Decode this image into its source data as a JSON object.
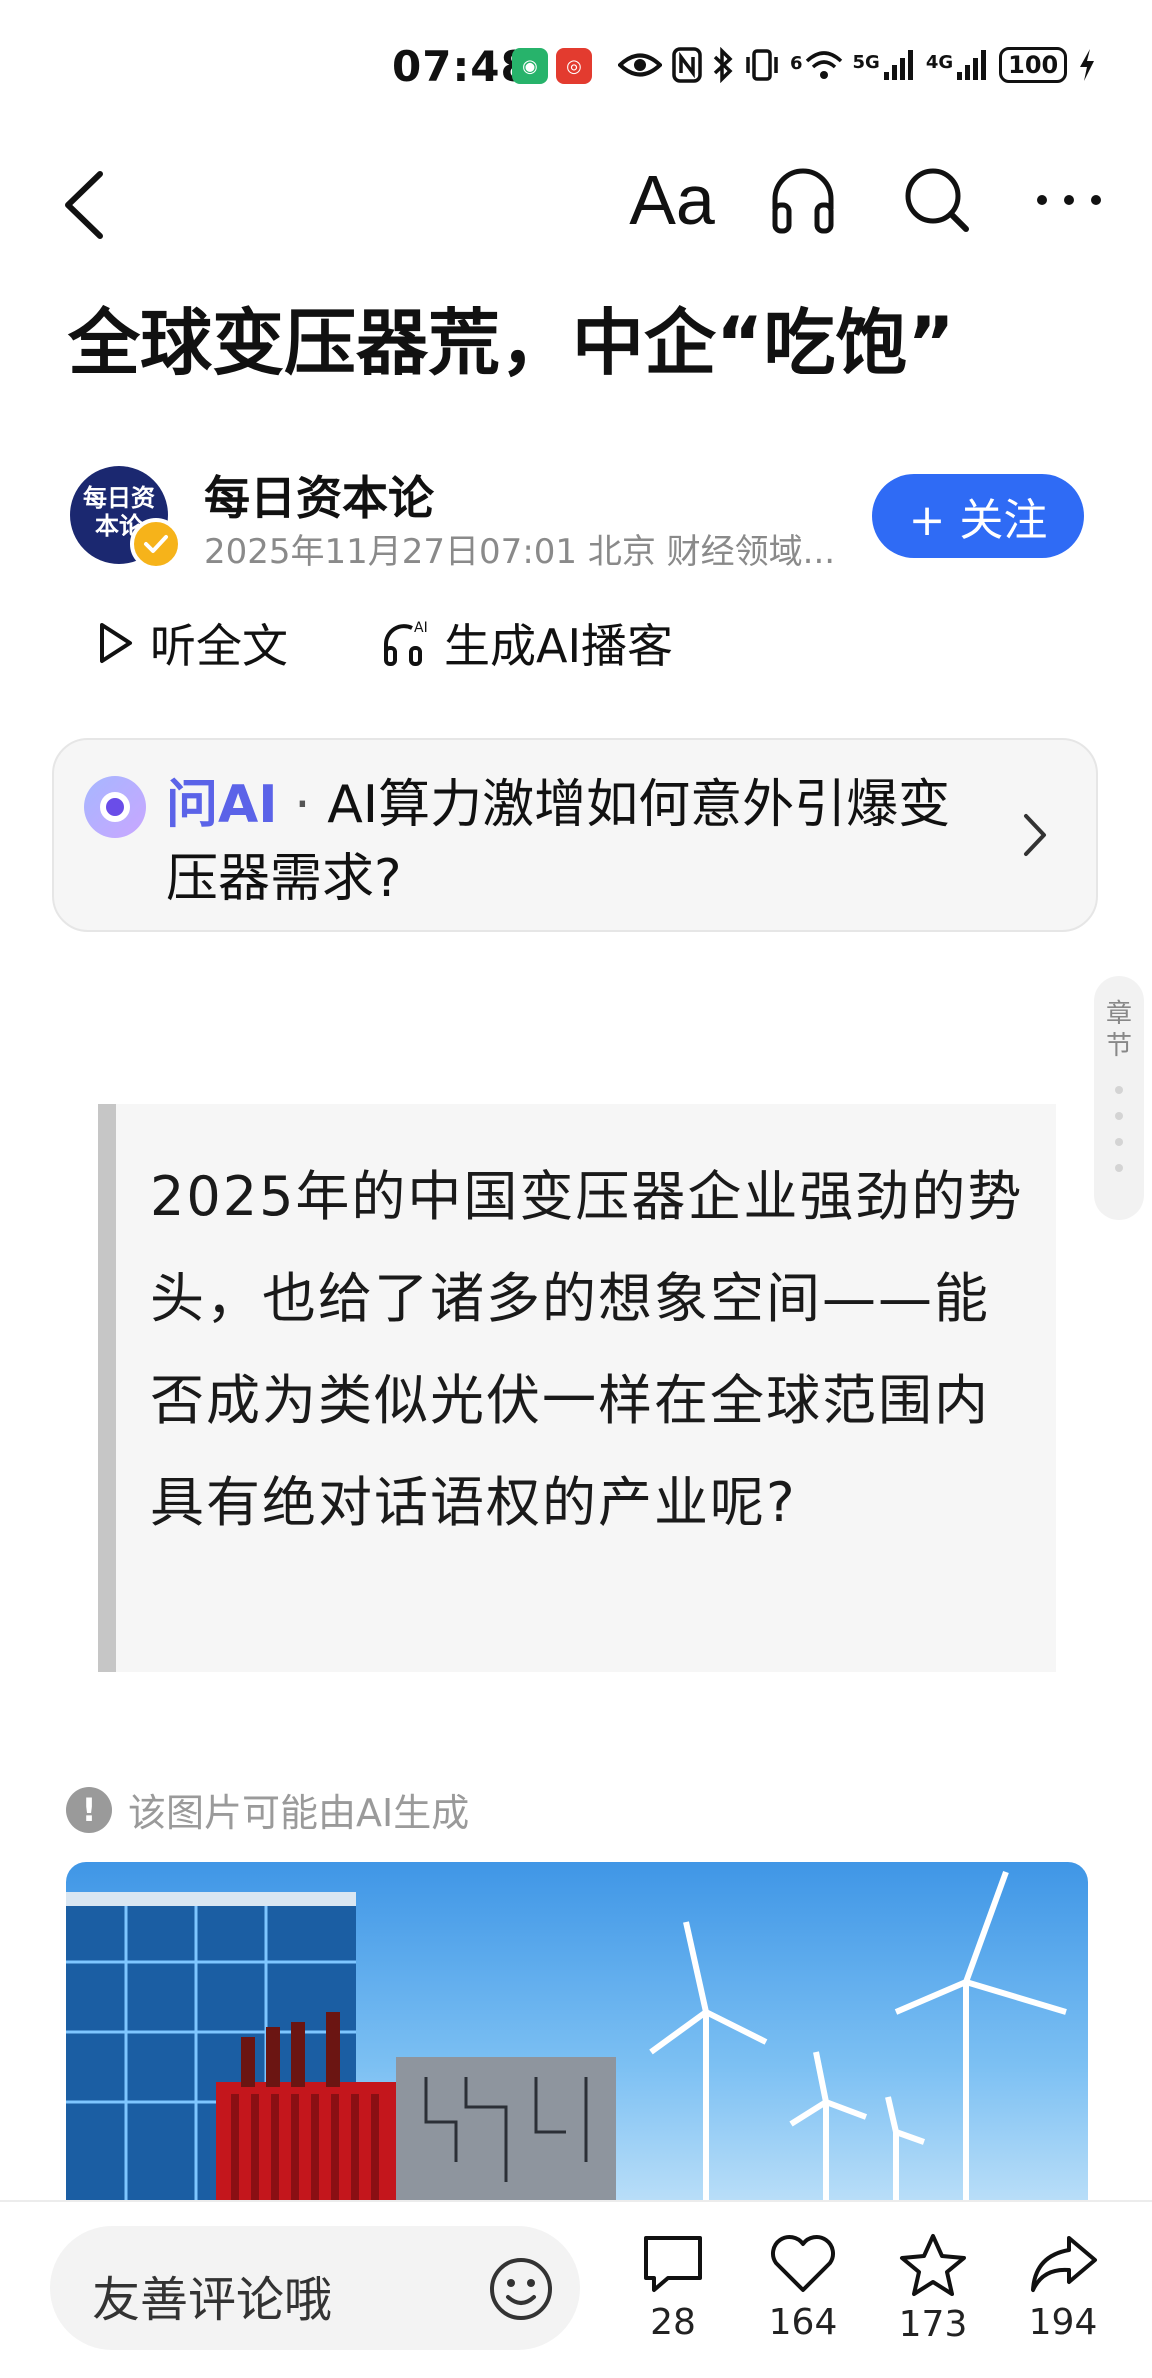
{
  "status_bar": {
    "time": "07:48",
    "battery": "100",
    "net1": "5G",
    "net2": "4G",
    "wifi_label": "6"
  },
  "nav": {
    "font_label": "Aa"
  },
  "article": {
    "title": "全球变压器荒，中企“吃饱”",
    "author": {
      "name": "每日资本论",
      "avatar_text": "每日资本论",
      "meta": "2025年11月27日07:01 北京 财经领域..."
    },
    "follow_label": "+ 关注",
    "listen_label": "听全文",
    "podcast_label": "生成AI播客",
    "ask_ai": {
      "brand": "问AI",
      "separator": " · ",
      "question": "AI算力激增如何意外引爆变压器需求?"
    },
    "chapter_label": "章节",
    "quote": "2025年的中国变压器企业强劲的势头，也给了诸多的想象空间——能否成为类似光伏一样在全球范围内具有绝对话语权的产业呢?",
    "ai_image_notice": "该图片可能由AI生成"
  },
  "bottom_bar": {
    "comment_placeholder": "友善评论哦",
    "comments": "28",
    "likes": "164",
    "favorites": "173",
    "shares": "194"
  },
  "colors": {
    "accent": "#2f6bf5",
    "ai_brand": "#5b63e8"
  }
}
